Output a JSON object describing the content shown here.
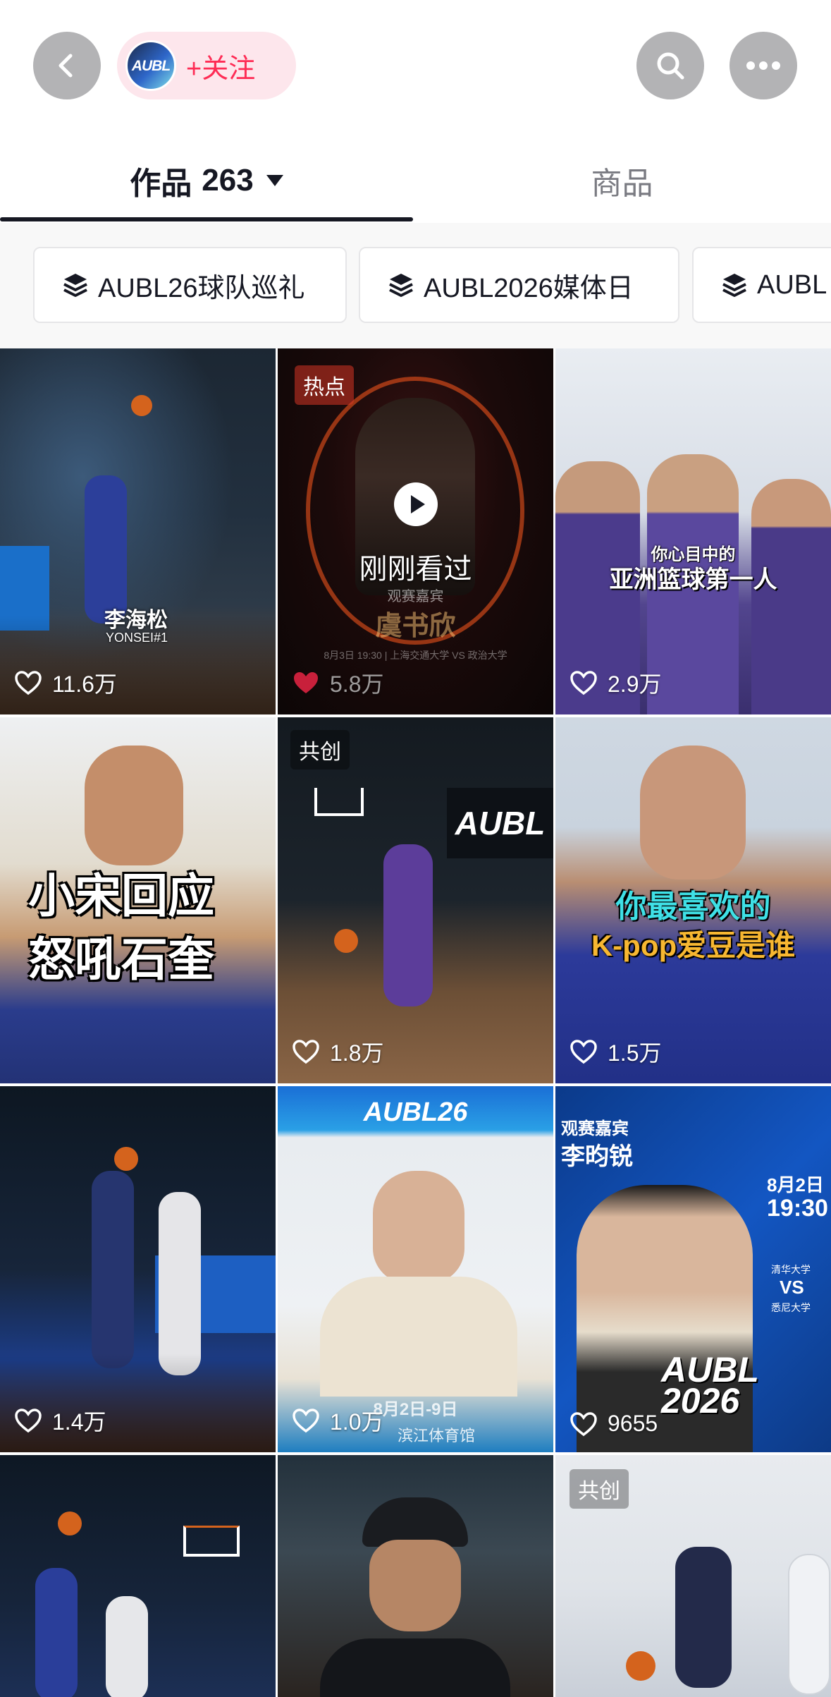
{
  "header": {
    "follow_label": "+关注",
    "avatar_text": "AUBL",
    "icons": [
      "back-icon",
      "search-icon",
      "more-icon"
    ]
  },
  "tabs": {
    "works_label": "作品",
    "works_count": "263",
    "goods_label": "商品"
  },
  "collections": [
    {
      "label": "AUBL26球队巡礼",
      "icon": "layers-icon"
    },
    {
      "label": "AUBL2026媒体日",
      "icon": "layers-icon"
    },
    {
      "label": "AUBL",
      "icon": "layers-icon"
    }
  ],
  "videos": [
    {
      "likes": "11.6万",
      "caption": "李海松",
      "subcaption": "YONSEI#1",
      "liked": false
    },
    {
      "likes": "5.8万",
      "tag": "热点",
      "status": "刚刚看过",
      "subtitle": "观赛嘉宾",
      "name": "虞书欣",
      "event": "8月3日 19:30 | 上海交通大学 VS 政治大学",
      "liked": true
    },
    {
      "likes": "2.9万",
      "overlay_line1": "你心目中的",
      "overlay_line2": "亚洲篮球第一人",
      "liked": false
    },
    {
      "likes": "",
      "overlay_line1": "小宋回应",
      "overlay_line2": "怒吼石奎",
      "liked": false
    },
    {
      "likes": "1.8万",
      "tag": "共创",
      "logo": "AUBL",
      "liked": false
    },
    {
      "likes": "1.5万",
      "overlay_line1": "你最喜欢的",
      "overlay_line2": "K-pop爱豆是谁",
      "liked": false
    },
    {
      "likes": "1.4万",
      "liked": false
    },
    {
      "likes": "1.0万",
      "banner": "AUBL26",
      "event": "8月2日-9日",
      "venue": "滨江体育馆",
      "liked": false
    },
    {
      "likes": "9655",
      "subtitle": "观赛嘉宾",
      "name": "李昀锐",
      "date": "8月2日",
      "time": "19:30",
      "team1": "清华大学",
      "vs": "VS",
      "team2": "悉尼大学",
      "logo": "AUBL 2026",
      "liked": false
    },
    {
      "likes": "",
      "liked": false
    },
    {
      "likes": "",
      "liked": false
    },
    {
      "likes": "",
      "tag": "共创",
      "liked": false
    }
  ],
  "colors": {
    "accent": "#fe2c55",
    "text_primary": "#161823",
    "text_secondary": "#7a7b82"
  }
}
